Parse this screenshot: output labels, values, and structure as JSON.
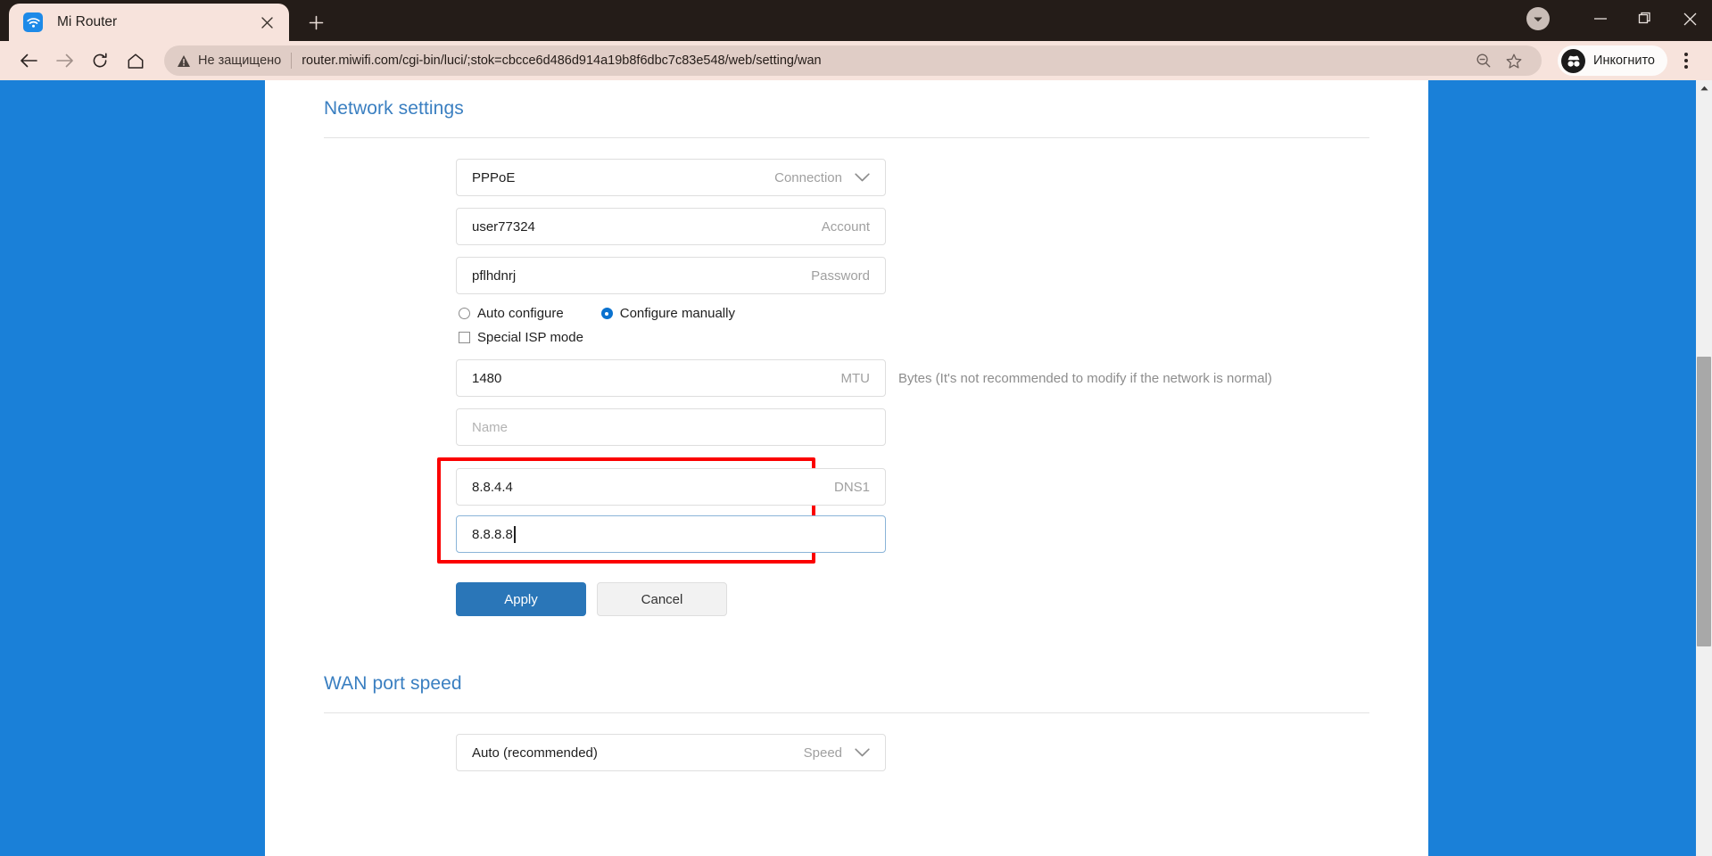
{
  "browser": {
    "tab": {
      "title": "Mi Router",
      "favicon": "wifi-icon",
      "close": "×"
    },
    "new_tab_label": "+",
    "nav": {
      "back": "back-arrow-icon",
      "forward": "forward-arrow-icon",
      "reload": "reload-icon",
      "home": "home-icon"
    },
    "omnibox": {
      "security_text": "Не защищено",
      "url": "router.miwifi.com/cgi-bin/luci/;stok=cbcce6d486d914a19b8f6dbc7c83e548/web/setting/wan",
      "zoom_icon": "zoom-out-icon",
      "bookmark_icon": "star-icon"
    },
    "incognito_label": "Инкогнито",
    "window_controls": {
      "minimize": "–",
      "maximize": "▢",
      "close": "✕"
    },
    "colors": {
      "chrome_dark": "#241c18",
      "chrome_surface": "#f7e3dc",
      "omnibox_bg": "#e0cdc6",
      "page_blue": "#1a80d8",
      "accent_blue": "#2a76b8",
      "heading_blue": "#3a7fc1",
      "highlight_red": "#fb0000"
    }
  },
  "page": {
    "network_settings": {
      "title": "Network settings",
      "connection": {
        "value": "PPPoE",
        "label": "Connection"
      },
      "account": {
        "value": "user77324",
        "label": "Account"
      },
      "password": {
        "value": "pflhdnrj",
        "label": "Password"
      },
      "config_mode": {
        "auto": {
          "label": "Auto configure",
          "checked": false
        },
        "manual": {
          "label": "Configure manually",
          "checked": true
        }
      },
      "special_isp": {
        "label": "Special ISP mode",
        "checked": false
      },
      "mtu": {
        "value": "1480",
        "label": "MTU",
        "hint": "Bytes (It's not recommended to modify if the network is normal)"
      },
      "name": {
        "value": "",
        "placeholder": "Name",
        "label": ""
      },
      "dns1": {
        "value": "8.8.4.4",
        "label": "DNS1"
      },
      "dns2": {
        "value": "8.8.8.8",
        "label": "",
        "focused": true
      },
      "apply_button": "Apply",
      "cancel_button": "Cancel"
    },
    "wan_port_speed": {
      "title": "WAN port speed",
      "speed": {
        "value": "Auto (recommended)",
        "label": "Speed"
      }
    }
  }
}
